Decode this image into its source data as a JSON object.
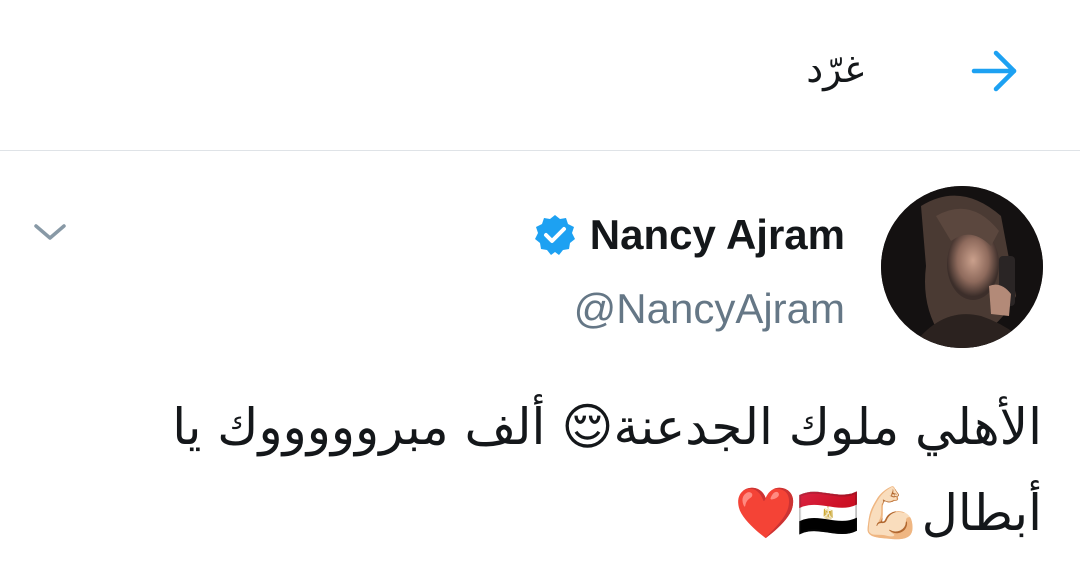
{
  "header": {
    "title": "غرّد",
    "back_icon": "arrow-right-icon",
    "accent": "#1da1f2"
  },
  "tweet": {
    "display_name": "Nancy Ajram",
    "verified": true,
    "verified_icon": "verified-badge-icon",
    "handle": "@NancyAjram",
    "menu_icon": "chevron-down-icon",
    "text": "الأهلي ملوك الجدعنة😌 ألف مبروووووك يا أبطال💪🏻🇪🇬❤️"
  },
  "colors": {
    "text_primary": "#14171a",
    "text_secondary": "#657786",
    "divider": "#dfe3e7",
    "verified_blue": "#1da1f2"
  }
}
